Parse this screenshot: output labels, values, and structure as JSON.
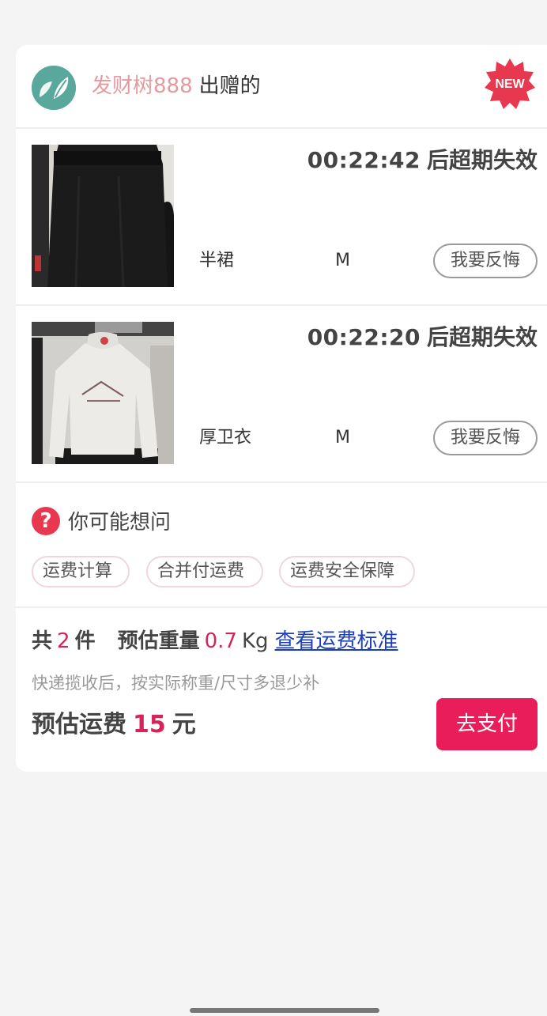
{
  "giver": {
    "name": "发财树888",
    "suffix": "出赠的",
    "badge": "NEW"
  },
  "items": [
    {
      "countdown": "00:22:42",
      "expiry_suffix": "后超期失效",
      "name": "半裙",
      "size": "M",
      "regret_label": "我要反悔"
    },
    {
      "countdown": "00:22:20",
      "expiry_suffix": "后超期失效",
      "name": "厚卫衣",
      "size": "M",
      "regret_label": "我要反悔"
    }
  ],
  "faq": {
    "title": "你可能想问",
    "icon": "question-icon",
    "chips": [
      "运费计算",
      "合并付运费",
      "运费安全保障"
    ]
  },
  "summary": {
    "total_prefix": "共",
    "count": "2",
    "count_unit": "件",
    "weight_label": "预估重量",
    "weight": "0.7",
    "weight_unit": "Kg",
    "link": "查看运费标准",
    "note": "快递揽收后，按实际称重/尺寸多退少补",
    "freight_label": "预估运费",
    "freight_amount": "15",
    "freight_unit": "元",
    "pay_label": "去支付"
  },
  "colors": {
    "accent": "#e81d5a",
    "price": "#d6245a",
    "giver_name": "#e59a9e",
    "link": "#1b3fc0",
    "avatar": "#5aa89b"
  }
}
